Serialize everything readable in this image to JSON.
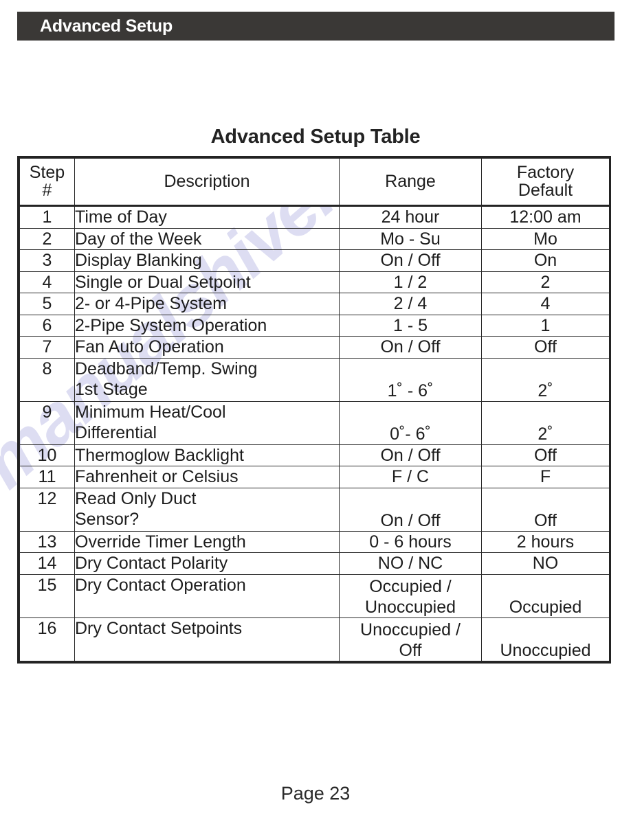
{
  "header": {
    "title": "Advanced Setup",
    "bar_color": "#3a3836",
    "text_color": "#ffffff"
  },
  "page_title": "Advanced Setup Table",
  "watermark": {
    "text": "manualshive.com",
    "color": "#9696d7"
  },
  "table": {
    "columns": [
      {
        "key": "step",
        "label_line1": "Step",
        "label_line2": "#"
      },
      {
        "key": "description",
        "label_line1": "Description",
        "label_line2": ""
      },
      {
        "key": "range",
        "label_line1": "Range",
        "label_line2": ""
      },
      {
        "key": "factory_default",
        "label_line1": "Factory",
        "label_line2": "Default"
      }
    ],
    "rows": [
      {
        "step": "1",
        "desc_line1": "Time of Day",
        "desc_line2": "",
        "range_line1": "24 hour",
        "range_line2": "",
        "default_line1": "12:00 am",
        "default_line2": "",
        "tall": false
      },
      {
        "step": "2",
        "desc_line1": "Day of the Week",
        "desc_line2": "",
        "range_line1": "Mo - Su",
        "range_line2": "",
        "default_line1": "Mo",
        "default_line2": "",
        "tall": false
      },
      {
        "step": "3",
        "desc_line1": "Display Blanking",
        "desc_line2": "",
        "range_line1": "On / Off",
        "range_line2": "",
        "default_line1": "On",
        "default_line2": "",
        "tall": false
      },
      {
        "step": "4",
        "desc_line1": "Single or Dual Setpoint",
        "desc_line2": "",
        "range_line1": "1 / 2",
        "range_line2": "",
        "default_line1": "2",
        "default_line2": "",
        "tall": false
      },
      {
        "step": "5",
        "desc_line1": "2- or 4-Pipe System",
        "desc_line2": "",
        "range_line1": "2 / 4",
        "range_line2": "",
        "default_line1": "4",
        "default_line2": "",
        "tall": false
      },
      {
        "step": "6",
        "desc_line1": "2-Pipe System Operation",
        "desc_line2": "",
        "range_line1": "1 - 5",
        "range_line2": "",
        "default_line1": "1",
        "default_line2": "",
        "tall": false
      },
      {
        "step": "7",
        "desc_line1": "Fan Auto Operation",
        "desc_line2": "",
        "range_line1": "On / Off",
        "range_line2": "",
        "default_line1": "Off",
        "default_line2": "",
        "tall": false
      },
      {
        "step": "8",
        "desc_line1": "Deadband/Temp. Swing",
        "desc_line2": "1st Stage",
        "range_line1": "1˚ - 6˚",
        "range_line2": "",
        "default_line1": "2˚",
        "default_line2": "",
        "tall": true
      },
      {
        "step": "9",
        "desc_line1": "Minimum Heat/Cool",
        "desc_line2": "Differential",
        "range_line1": "0˚- 6˚",
        "range_line2": "",
        "default_line1": "2˚",
        "default_line2": "",
        "tall": true
      },
      {
        "step": "10",
        "desc_line1": "Thermoglow Backlight",
        "desc_line2": "",
        "range_line1": "On / Off",
        "range_line2": "",
        "default_line1": "Off",
        "default_line2": "",
        "tall": false
      },
      {
        "step": "11",
        "desc_line1": "Fahrenheit or Celsius",
        "desc_line2": "",
        "range_line1": "F / C",
        "range_line2": "",
        "default_line1": "F",
        "default_line2": "",
        "tall": false
      },
      {
        "step": "12",
        "desc_line1": "Read Only Duct",
        "desc_line2": "Sensor?",
        "range_line1": "On / Off",
        "range_line2": "",
        "default_line1": "Off",
        "default_line2": "",
        "tall": true
      },
      {
        "step": "13",
        "desc_line1": "Override Timer Length",
        "desc_line2": "",
        "range_line1": "0 - 6 hours",
        "range_line2": "",
        "default_line1": "2 hours",
        "default_line2": "",
        "tall": false
      },
      {
        "step": "14",
        "desc_line1": "Dry Contact Polarity",
        "desc_line2": "",
        "range_line1": "NO / NC",
        "range_line2": "",
        "default_line1": "NO",
        "default_line2": "",
        "tall": false
      },
      {
        "step": "15",
        "desc_line1": "Dry Contact Operation",
        "desc_line2": "",
        "range_line1": "Occupied /",
        "range_line2": "Unoccupied",
        "default_line1": "Occupied",
        "default_line2": "",
        "tall": true
      },
      {
        "step": "16",
        "desc_line1": "Dry Contact Setpoints",
        "desc_line2": "",
        "range_line1": "Unoccupied /",
        "range_line2": "Off",
        "default_line1": "Unoccupied",
        "default_line2": "",
        "tall": true
      }
    ]
  },
  "footer": {
    "page_label": "Page 23"
  }
}
